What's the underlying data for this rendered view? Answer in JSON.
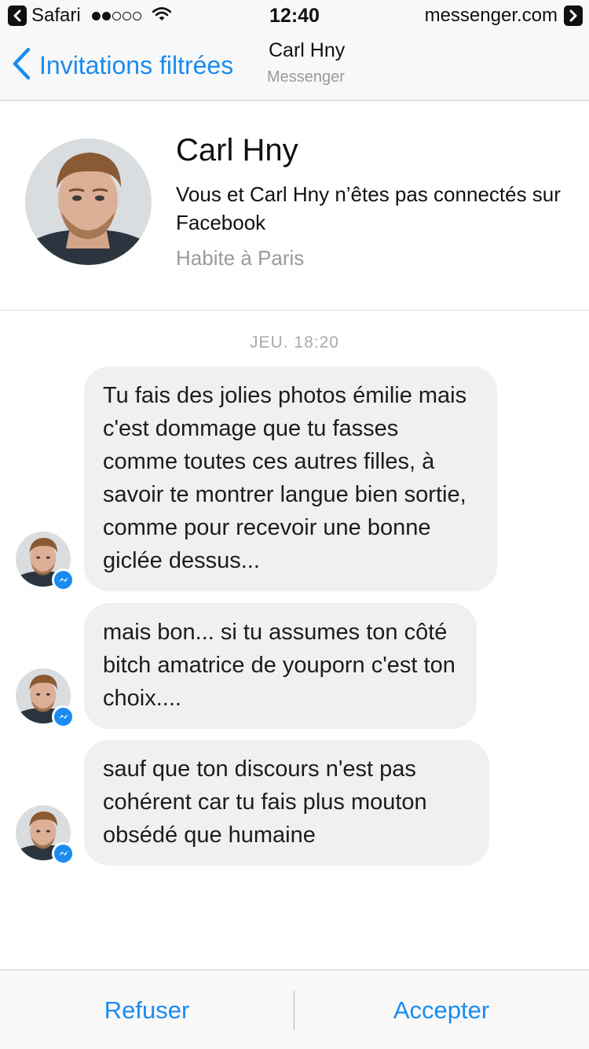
{
  "status_bar": {
    "app_name": "Safari",
    "time": "12:40",
    "domain": "messenger.com",
    "signal_bars_filled": 2,
    "signal_bars_total": 5
  },
  "nav": {
    "back_label": "Invitations filtrées",
    "title": "Carl Hny",
    "subtitle": "Messenger",
    "accent_color": "#1a8cf0"
  },
  "profile": {
    "name": "Carl Hny",
    "description": "Vous et Carl Hny n’êtes pas connectés sur Facebook",
    "location": "Habite à Paris"
  },
  "thread": {
    "timestamp": "JEU. 18:20",
    "messages": [
      {
        "text": "Tu fais des jolies photos émilie mais c'est dommage que tu fasses comme toutes ces autres filles, à savoir te montrer langue bien sortie, comme pour recevoir une bonne giclée dessus..."
      },
      {
        "text": "mais bon... si tu assumes ton côté bitch amatrice de youporn c'est ton choix...."
      },
      {
        "text": "sauf que ton discours n'est pas cohérent car tu fais plus mouton obsédé que humaine"
      }
    ]
  },
  "actions": {
    "decline_label": "Refuser",
    "accept_label": "Accepter"
  }
}
